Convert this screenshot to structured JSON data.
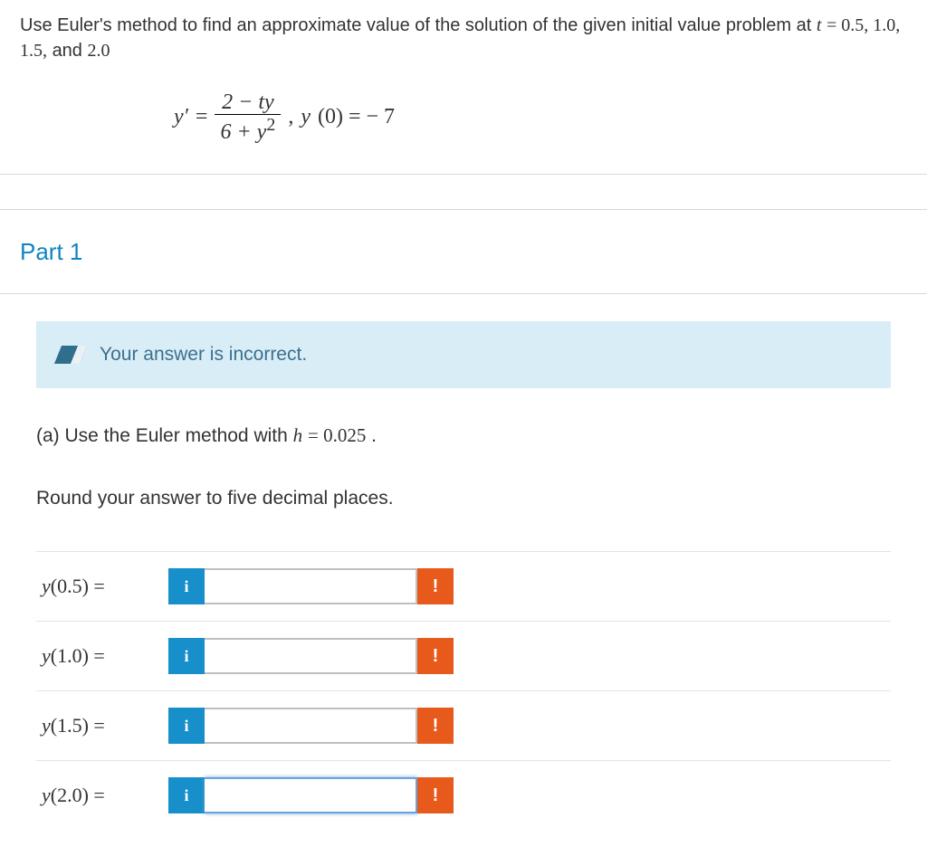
{
  "prompt": {
    "text_prefix": "Use Euler's method to find an approximate value of the solution of the given initial value problem at ",
    "t_var": "t",
    "equals": " = ",
    "t_values": "0.5,  1.0,  1.5,",
    "and_word": "  and ",
    "t_last": "2.0"
  },
  "equation": {
    "lhs": "y′",
    "eq1": " = ",
    "num": "2 − ty",
    "den": "6 + y",
    "den_exp": "2",
    "comma": ",   ",
    "ic_y": "y",
    "ic_paren": "(0) = − 7"
  },
  "part": {
    "heading": "Part 1",
    "alert": "Your answer is incorrect.",
    "sub_prefix": "(a) Use the Euler method with ",
    "h_var": "h",
    "h_eq": " = ",
    "h_value": "0.025",
    "h_period": ".",
    "round_instructions": "Round your answer to five decimal places."
  },
  "answers": [
    {
      "label_y": "y",
      "label_paren": "(0.5) =",
      "value": "",
      "focused": false
    },
    {
      "label_y": "y",
      "label_paren": "(1.0) =",
      "value": "",
      "focused": false
    },
    {
      "label_y": "y",
      "label_paren": "(1.5) =",
      "value": "",
      "focused": false
    },
    {
      "label_y": "y",
      "label_paren": "(2.0) =",
      "value": "",
      "focused": true
    }
  ],
  "icons": {
    "info": "i",
    "error": "!"
  }
}
